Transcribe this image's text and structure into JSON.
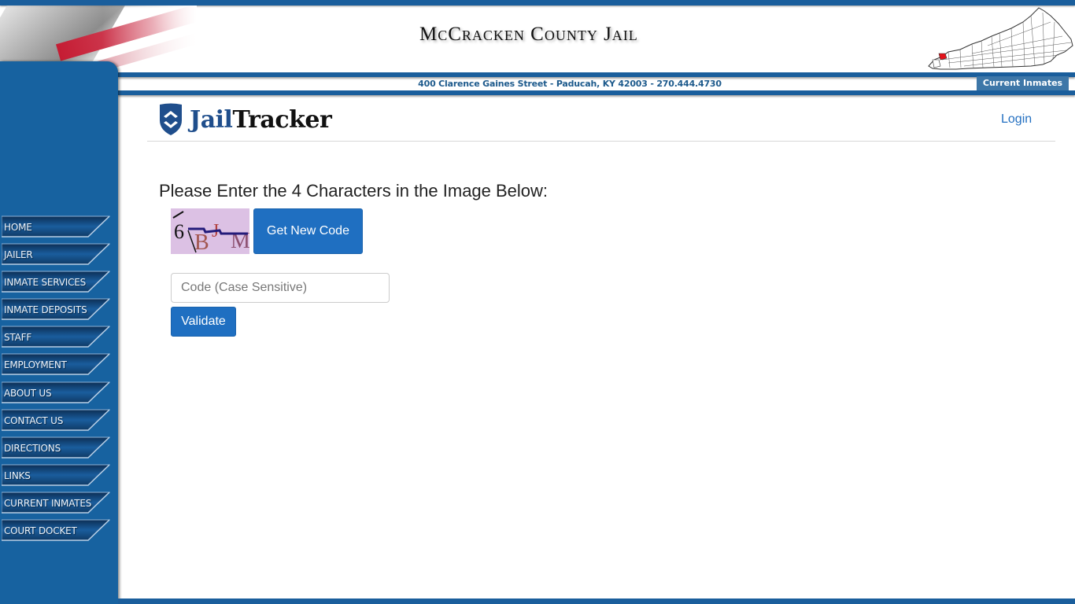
{
  "header": {
    "site_title": "McCracken County Jail",
    "address": "400 Clarence Gaines Street - Paducah, KY 42003 - 270.444.4730",
    "current_inmates_tab": "Current Inmates",
    "highlight_color": "#e3131b",
    "brand_color": "#1a5e9c"
  },
  "sidebar": {
    "items": [
      {
        "label": "HOME"
      },
      {
        "label": "JAILER"
      },
      {
        "label": "INMATE SERVICES"
      },
      {
        "label": "INMATE DEPOSITS"
      },
      {
        "label": "STAFF"
      },
      {
        "label": "EMPLOYMENT"
      },
      {
        "label": "ABOUT US"
      },
      {
        "label": "CONTACT US"
      },
      {
        "label": "DIRECTIONS"
      },
      {
        "label": "LINKS"
      },
      {
        "label": "CURRENT INMATES"
      },
      {
        "label": "COURT DOCKET"
      }
    ]
  },
  "jailtracker": {
    "logo_part1": "Jail",
    "logo_part2": "Tracker",
    "login_label": "Login"
  },
  "captcha": {
    "prompt": "Please Enter the 4 Characters in the Image Below:",
    "image_chars": [
      "6",
      "B",
      "J",
      "M"
    ],
    "new_code_label": "Get New Code",
    "input_placeholder": "Code (Case Sensitive)",
    "input_value": "",
    "validate_label": "Validate"
  }
}
